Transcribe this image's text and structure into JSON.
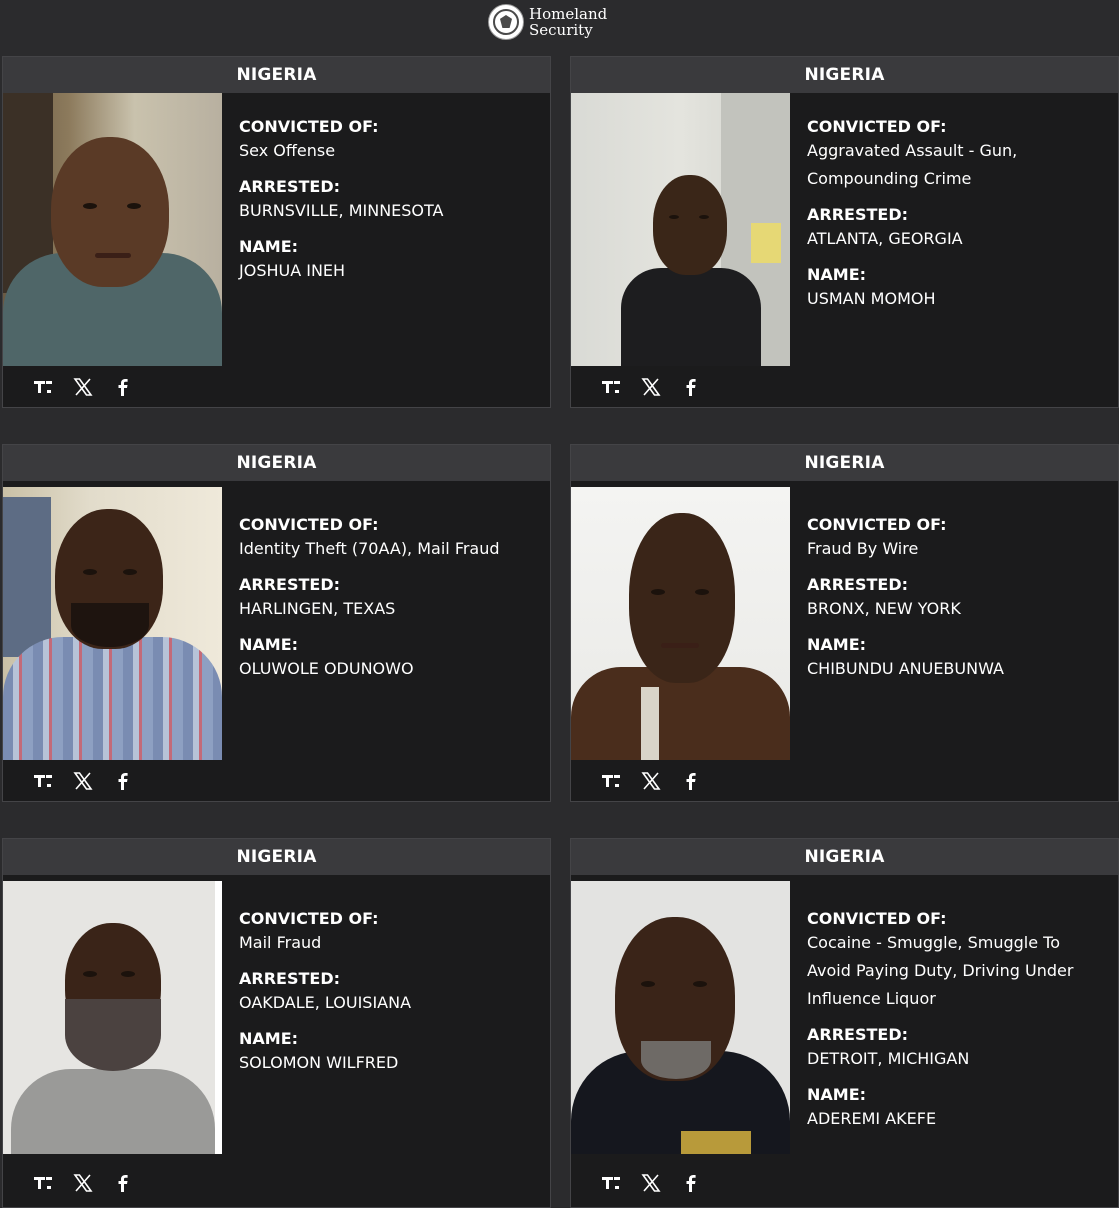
{
  "header": {
    "logo_line1": "Homeland",
    "logo_line2": "Security",
    "seal_icon": "dhs-seal-icon"
  },
  "labels": {
    "convicted": "CONVICTED OF:",
    "arrested": "ARRESTED:",
    "name": "NAME:"
  },
  "cards": [
    {
      "country": "NIGERIA",
      "convicted_of": "Sex Offense",
      "arrested": "BURNSVILLE, MINNESOTA",
      "name": "JOSHUA INEH"
    },
    {
      "country": "NIGERIA",
      "convicted_of": "Aggravated Assault - Gun, Compounding Crime",
      "arrested": "ATLANTA, GEORGIA",
      "name": "USMAN MOMOH"
    },
    {
      "country": "NIGERIA",
      "convicted_of": "Identity Theft (70AA), Mail Fraud",
      "arrested": "HARLINGEN, TEXAS",
      "name": "OLUWOLE ODUNOWO"
    },
    {
      "country": "NIGERIA",
      "convicted_of": "Fraud By Wire",
      "arrested": "BRONX, NEW YORK",
      "name": "CHIBUNDU ANUEBUNWA"
    },
    {
      "country": "NIGERIA",
      "convicted_of": "Mail Fraud",
      "arrested": "OAKDALE, LOUISIANA",
      "name": "SOLOMON WILFRED"
    },
    {
      "country": "NIGERIA",
      "convicted_of": "Cocaine - Smuggle, Smuggle To Avoid Paying Duty, Driving Under Influence Liquor",
      "arrested": "DETROIT, MICHIGAN",
      "name": "ADEREMI AKEFE"
    }
  ],
  "share_icons": [
    "truth-social-icon",
    "x-icon",
    "facebook-icon"
  ],
  "colors": {
    "page_bg": "#2b2b2d",
    "card_bg": "#1b1b1c",
    "card_header_bg": "#3a3a3d",
    "text": "#ffffff"
  }
}
